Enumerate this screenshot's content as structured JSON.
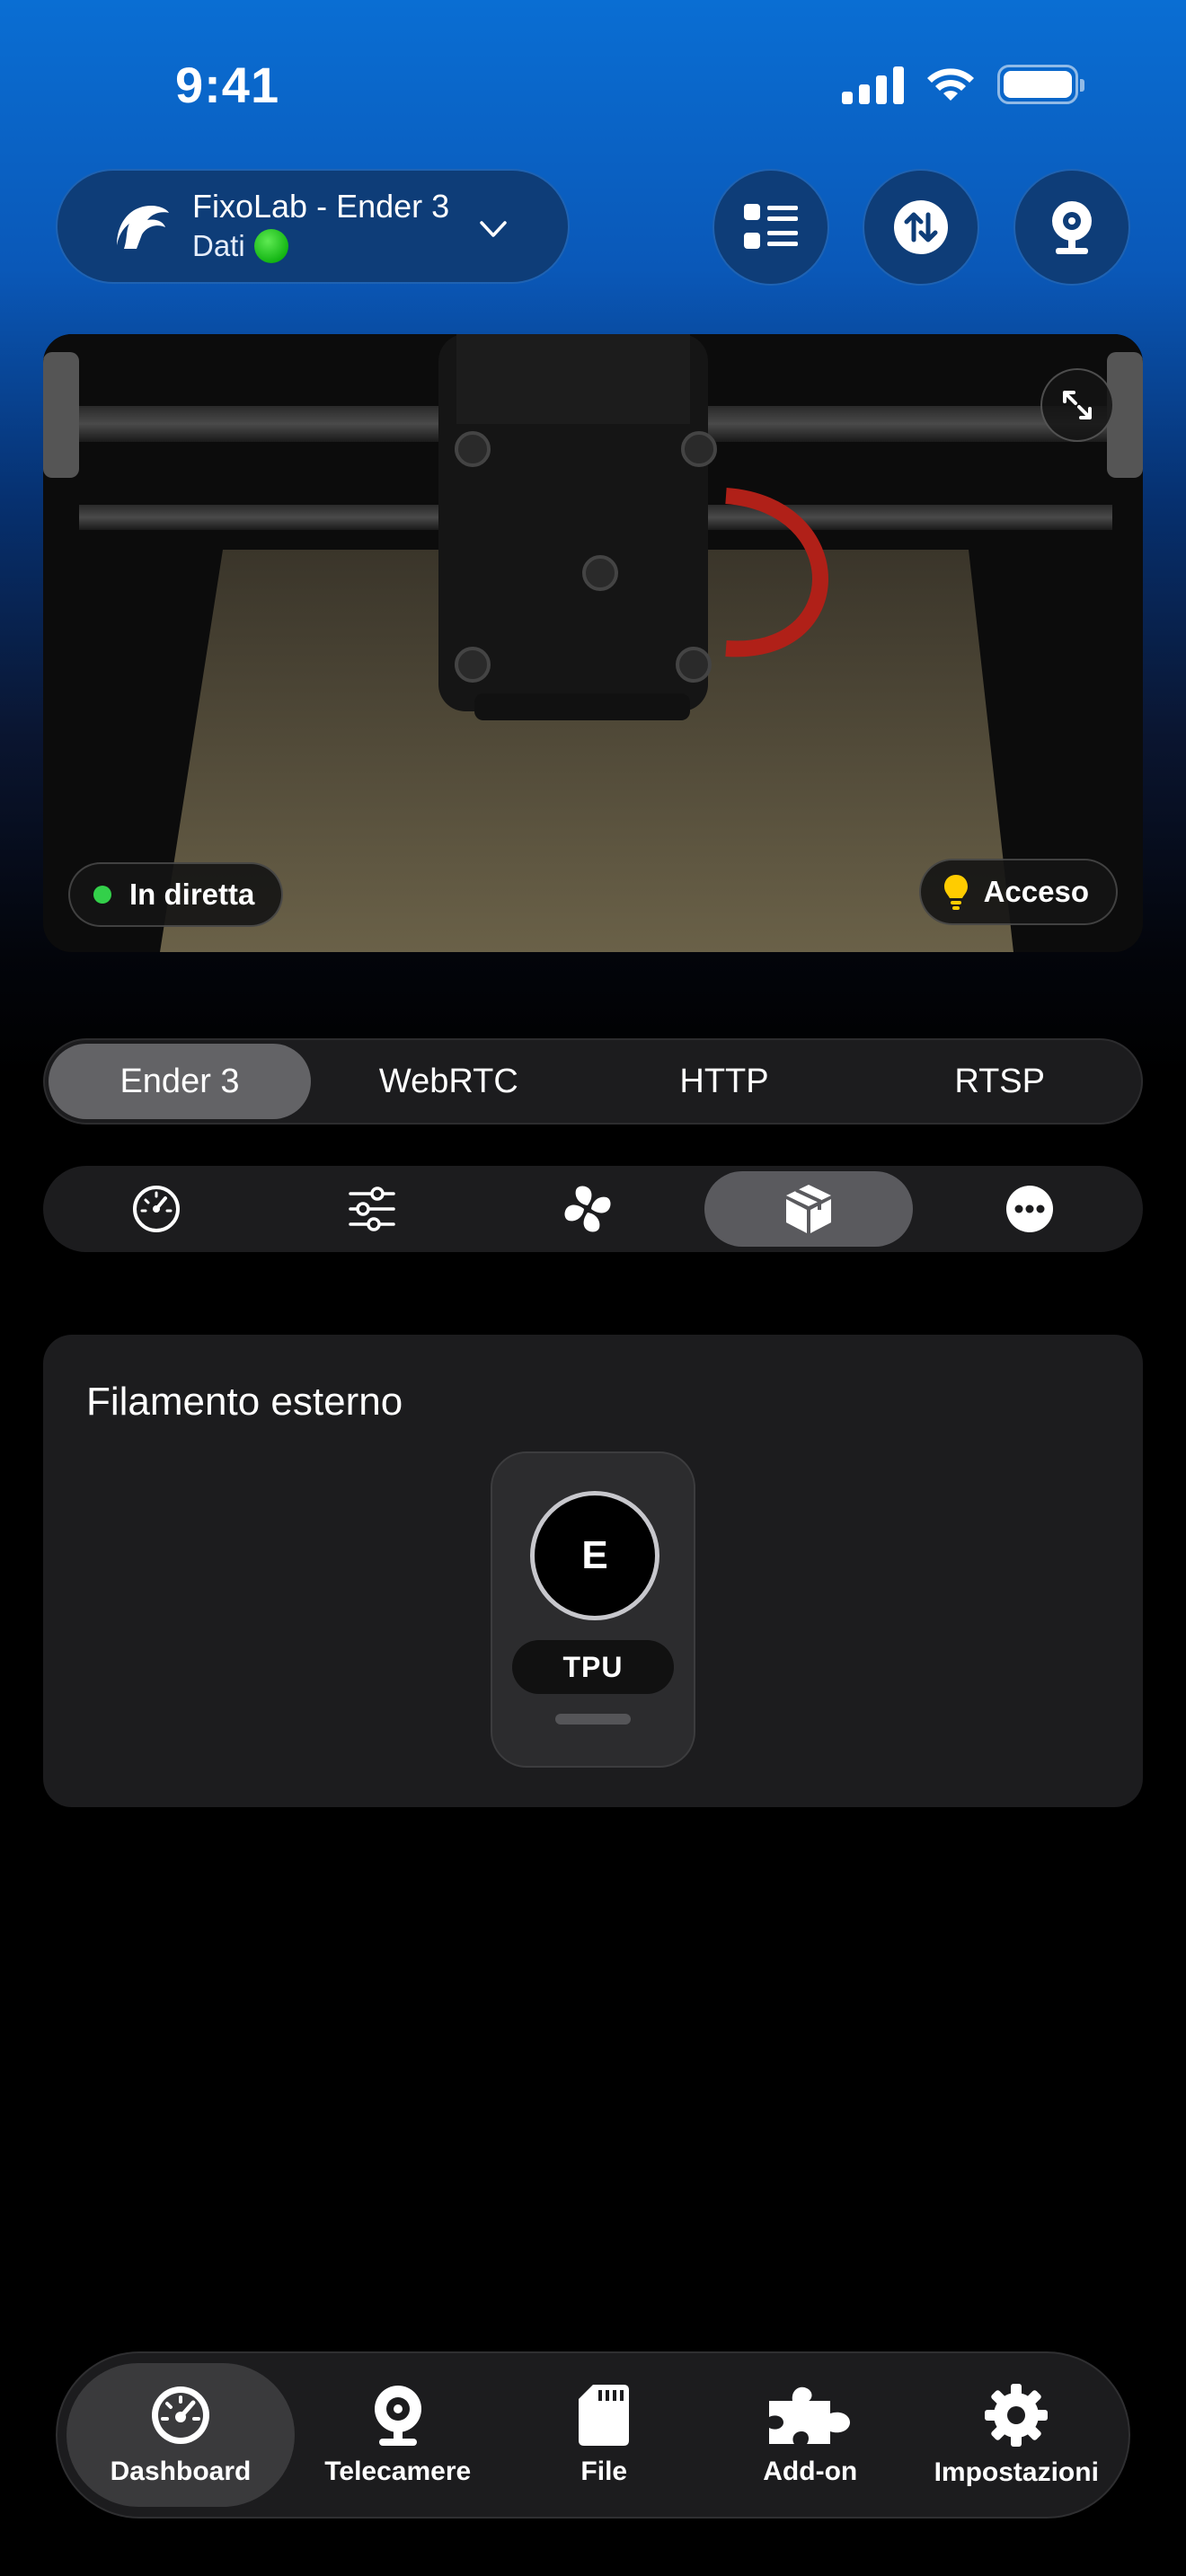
{
  "status_bar": {
    "time": "9:41"
  },
  "header": {
    "printer_name": "FixoLab - Ender 3",
    "printer_sub": "Dati",
    "icons": [
      "list-icon",
      "transfer-icon",
      "webcam-icon"
    ]
  },
  "camera": {
    "live_label": "In diretta",
    "light_label": "Acceso"
  },
  "stream_tabs": [
    {
      "label": "Ender 3",
      "active": true
    },
    {
      "label": "WebRTC",
      "active": false
    },
    {
      "label": "HTTP",
      "active": false
    },
    {
      "label": "RTSP",
      "active": false
    }
  ],
  "control_tabs": [
    {
      "icon": "gauge-icon",
      "active": false
    },
    {
      "icon": "sliders-icon",
      "active": false
    },
    {
      "icon": "fan-icon",
      "active": false
    },
    {
      "icon": "box-icon",
      "active": true
    },
    {
      "icon": "more-icon",
      "active": false
    }
  ],
  "filament": {
    "title": "Filamento esterno",
    "slot_letter": "E",
    "material": "TPU"
  },
  "bottom_nav": [
    {
      "label": "Dashboard",
      "icon": "gauge-icon",
      "active": true
    },
    {
      "label": "Telecamere",
      "icon": "webcam-icon",
      "active": false
    },
    {
      "label": "File",
      "icon": "sd-card-icon",
      "active": false
    },
    {
      "label": "Add-on",
      "icon": "puzzle-icon",
      "active": false
    },
    {
      "label": "Impostazioni",
      "icon": "gear-icon",
      "active": false
    }
  ]
}
